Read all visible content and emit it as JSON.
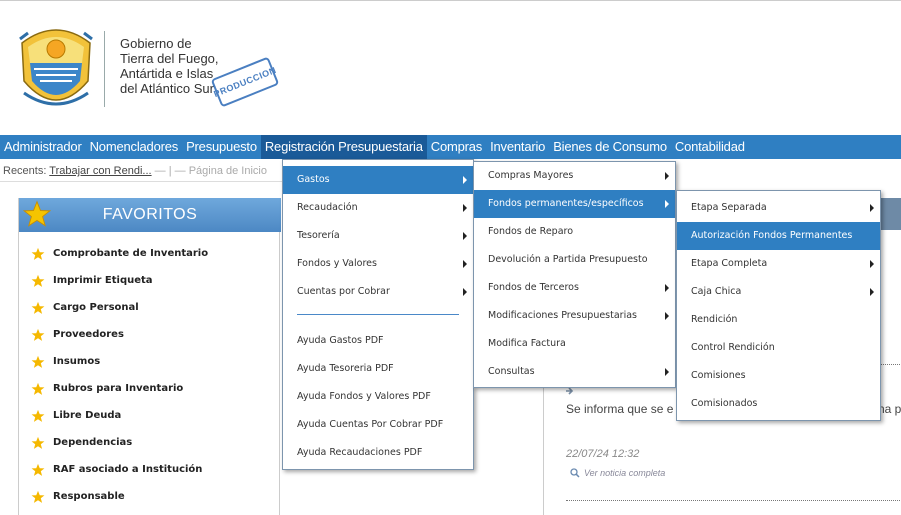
{
  "header": {
    "org_lines": [
      "Gobierno de",
      "Tierra del Fuego,",
      "Antártida e Islas",
      "del Atlántico Sur"
    ],
    "stamp_text": "PRODUCCION"
  },
  "menubar": {
    "items": [
      "Administrador",
      "Nomencladores",
      "Presupuesto",
      "Registración Presupuestaria",
      "Compras",
      "Inventario",
      "Bienes de Consumo",
      "Contabilidad"
    ],
    "active_index": 3
  },
  "recents": {
    "label": "Recents:",
    "link1": "Trabajar con Rendi...",
    "separator": "— | —",
    "link2": "Página de Inicio"
  },
  "favorites": {
    "title": "FAVORITOS",
    "items": [
      "Comprobante de Inventario",
      "Imprimir Etiqueta",
      "Cargo Personal",
      "Proveedores",
      "Insumos",
      "Rubros para Inventario",
      "Libre Deuda",
      "Dependencias",
      "RAF asociado a Institución",
      "Responsable"
    ]
  },
  "news": {
    "text": "Se informa que se e",
    "tail": "na p",
    "date": "22/07/24 12:32",
    "link": "Ver noticia completa"
  },
  "menu1": {
    "items": [
      {
        "label": "Gastos",
        "submenu": true,
        "highlighted": true
      },
      {
        "label": "Recaudación",
        "submenu": true
      },
      {
        "label": "Tesorería",
        "submenu": true
      },
      {
        "label": "Fondos y Valores",
        "submenu": true
      },
      {
        "label": "Cuentas por Cobrar",
        "submenu": true
      }
    ],
    "help_items": [
      "Ayuda Gastos PDF",
      "Ayuda Tesoreria PDF",
      "Ayuda Fondos y Valores PDF",
      "Ayuda Cuentas Por Cobrar PDF",
      "Ayuda Recaudaciones PDF"
    ]
  },
  "menu2": {
    "items": [
      {
        "label": "Compras Mayores",
        "submenu": true
      },
      {
        "label": "Fondos permanentes/específicos",
        "submenu": true,
        "highlighted": true
      },
      {
        "label": "Fondos de Reparo",
        "submenu": false
      },
      {
        "label": "Devolución a Partida Presupuesto",
        "submenu": false
      },
      {
        "label": "Fondos de Terceros",
        "submenu": true
      },
      {
        "label": "Modificaciones Presupuestarias",
        "submenu": true
      },
      {
        "label": "Modifica Factura",
        "submenu": false
      },
      {
        "label": "Consultas",
        "submenu": true
      }
    ]
  },
  "menu3": {
    "items": [
      {
        "label": "Etapa Separada",
        "submenu": true
      },
      {
        "label": "Autorización Fondos Permanentes",
        "submenu": false,
        "highlighted": true
      },
      {
        "label": "Etapa Completa",
        "submenu": true
      },
      {
        "label": "Caja Chica",
        "submenu": true
      },
      {
        "label": "Rendición",
        "submenu": false
      },
      {
        "label": "Control Rendición",
        "submenu": false
      },
      {
        "label": "Comisiones",
        "submenu": false
      },
      {
        "label": "Comisionados",
        "submenu": false
      }
    ]
  },
  "colors": {
    "menubar_bg": "#2f7fc2",
    "highlight": "#2f7fc2",
    "favorites_header": "#5b95cf",
    "star": "#f5b800"
  }
}
